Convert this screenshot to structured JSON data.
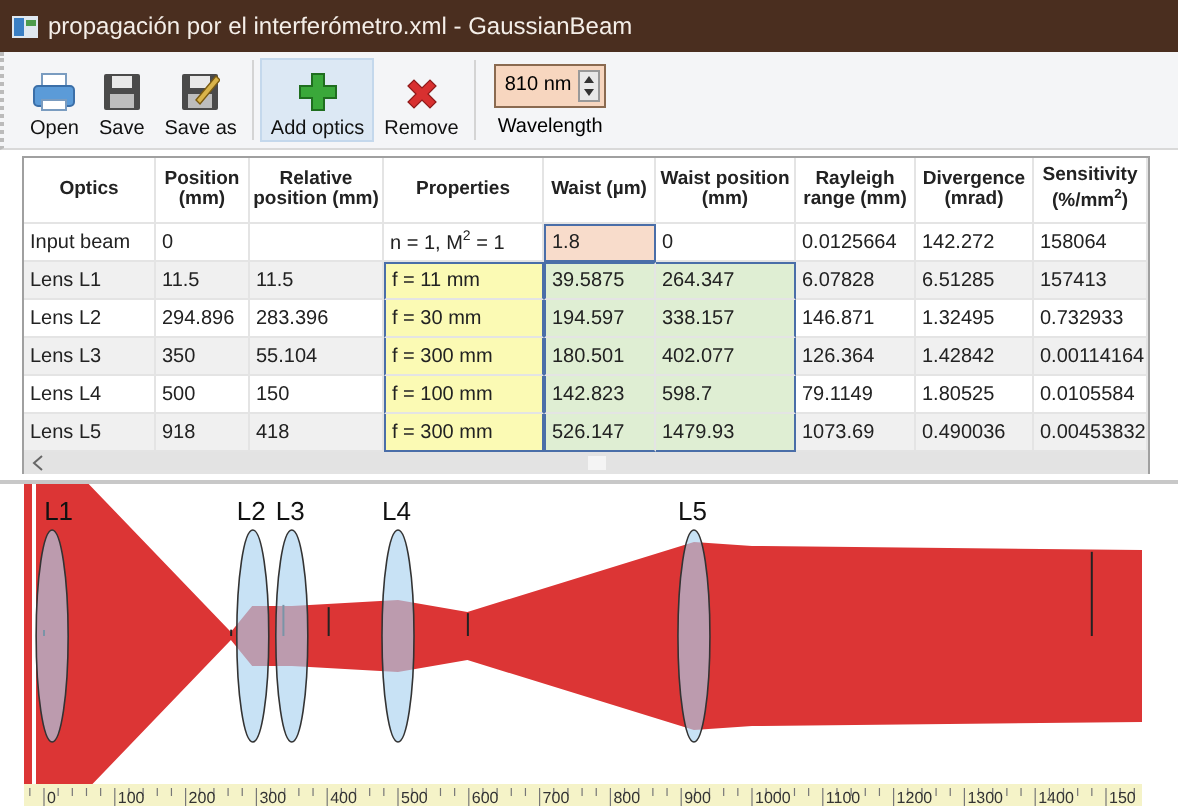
{
  "window": {
    "title": "propagación por el interferómetro.xml - GaussianBeam"
  },
  "toolbar": {
    "buttons": [
      {
        "kind": "open",
        "label": "Open",
        "selected": false
      },
      {
        "kind": "save",
        "label": "Save",
        "selected": false
      },
      {
        "kind": "saveas",
        "label": "Save as",
        "selected": false
      },
      {
        "kind": "add",
        "label": "Add optics",
        "selected": true
      },
      {
        "kind": "remove",
        "label": "Remove",
        "selected": false
      }
    ],
    "wavelength": {
      "value": "810 nm",
      "label": "Wavelength"
    }
  },
  "table": {
    "columns": [
      "Optics",
      "Position (mm)",
      "Relative position (mm)",
      "Properties",
      "Waist (µm)",
      "Waist position (mm)",
      "Rayleigh range (mm)",
      "Divergence (mrad)",
      "Sensitivity (%/mm$^{2}$)"
    ],
    "rows": [
      {
        "kind": "beam",
        "cells": [
          "Input beam",
          "0",
          "",
          "n = 1, M$^{2}$ = 1",
          "1.8",
          "0",
          "0.0125664",
          "142.272",
          "158064"
        ]
      },
      {
        "kind": "lens",
        "cells": [
          "Lens  L1",
          "11.5",
          "11.5",
          "f = 11 mm",
          "39.5875",
          "264.347",
          "6.07828",
          "6.51285",
          "157413"
        ]
      },
      {
        "kind": "lens",
        "cells": [
          "Lens  L2",
          "294.896",
          "283.396",
          "f = 30 mm",
          "194.597",
          "338.157",
          "146.871",
          "1.32495",
          "0.732933"
        ]
      },
      {
        "kind": "lens",
        "cells": [
          "Lens  L3",
          "350",
          "55.104",
          "f = 300 mm",
          "180.501",
          "402.077",
          "126.364",
          "1.42842",
          "0.00114164"
        ]
      },
      {
        "kind": "lens",
        "cells": [
          "Lens  L4",
          "500",
          "150",
          "f = 100 mm",
          "142.823",
          "598.7",
          "79.1149",
          "1.80525",
          "0.0105584"
        ]
      },
      {
        "kind": "lens",
        "cells": [
          "Lens  L5",
          "918",
          "418",
          "f = 300 mm",
          "526.147",
          "1479.93",
          "1073.69",
          "0.490036",
          "0.00453832"
        ]
      }
    ]
  },
  "plot": {
    "lens_labels": [
      "L1",
      "L2",
      "L3",
      "L4",
      "L5"
    ],
    "ruler_labels": [
      "0",
      "100",
      "200",
      "300",
      "400",
      "500",
      "600",
      "700",
      "800",
      "900",
      "1000",
      "1100",
      "1200",
      "1300",
      "1400",
      "150"
    ]
  }
}
